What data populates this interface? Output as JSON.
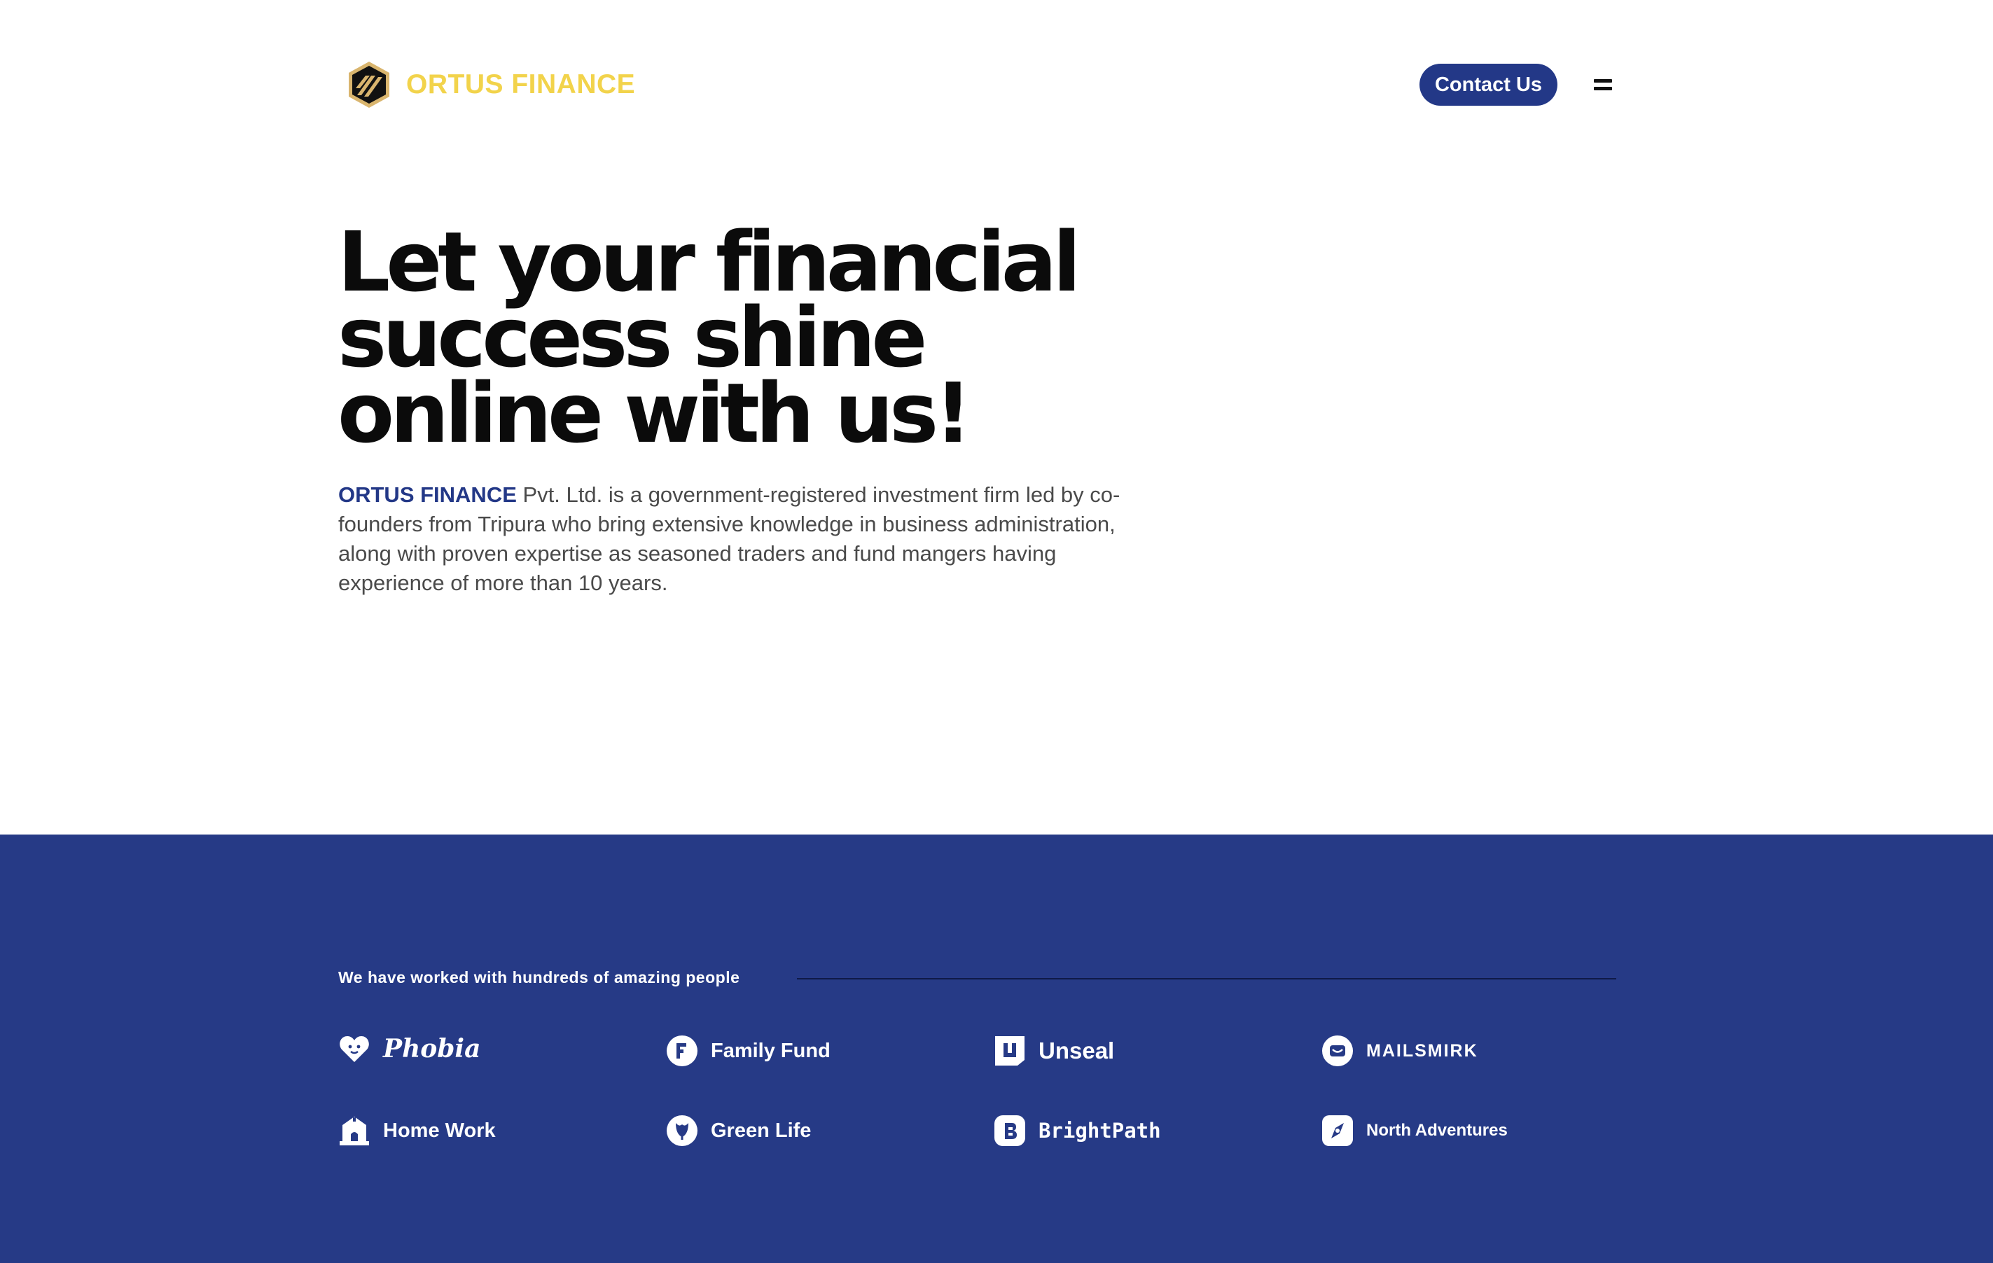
{
  "brand": {
    "name": "ORTUS FINANCE",
    "color": "#f2d34b"
  },
  "nav": {
    "contact_label": "Contact Us",
    "menu_icon": "hamburger-icon"
  },
  "hero": {
    "title_lines": [
      "Let your financial",
      "success shine",
      "online with us!"
    ],
    "desc_brand": "ORTUS FINANCE",
    "desc_rest": " Pvt. Ltd. is a government-registered investment firm led by co-founders from Tripura who bring extensive knowledge in business administration, along with proven expertise as seasoned traders and fund mangers having experience of more than 10 years."
  },
  "partners": {
    "heading": "We have worked with hundreds of amazing people",
    "background": "#263a86",
    "logos": [
      {
        "name": "Phobia",
        "icon": "heart-icon"
      },
      {
        "name": "Family Fund",
        "icon": "family-fund-icon"
      },
      {
        "name": "Unseal",
        "icon": "unseal-icon"
      },
      {
        "name": "MAILSMIRK",
        "icon": "mail-smile-icon"
      },
      {
        "name": "Home Work",
        "icon": "home-icon"
      },
      {
        "name": "Green Life",
        "icon": "leaf-icon"
      },
      {
        "name": "BrightPath",
        "icon": "brightpath-icon"
      },
      {
        "name": "North Adventures",
        "icon": "compass-icon"
      }
    ]
  },
  "colors": {
    "primary": "#233887",
    "text": "#0b0b0b",
    "muted": "#4a4a4a"
  }
}
